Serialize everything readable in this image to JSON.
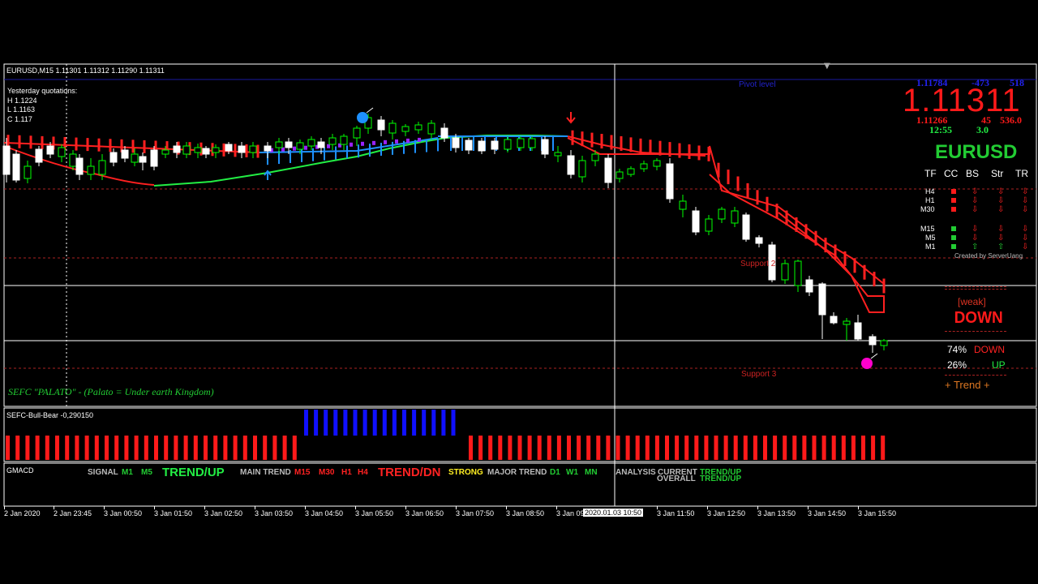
{
  "symbol_header": "EURUSD,M15  1.11301 1.11312 1.11290 1.11311",
  "yesterday": {
    "title": "Yesterday quotations:",
    "high": "H 1.1224",
    "low": "L 1.1163",
    "close": "C 1.117"
  },
  "levels": {
    "pivot": "Pivot level",
    "support2": "Support 2",
    "support3": "Support 3"
  },
  "quote_panel": {
    "top_price": "1.11784",
    "top_spread": "-473",
    "top_count": "518",
    "big_price": "1.11311",
    "low_price": "1.11266",
    "low_a": "45",
    "low_b": "536.0",
    "time": "12:55",
    "time_val": "3.0",
    "symbol": "EURUSD"
  },
  "tf_table": {
    "headers": [
      "TF",
      "CC",
      "BS",
      "Str",
      "TR"
    ],
    "rows": [
      {
        "tf": "H4",
        "cc": "red",
        "bs": "down",
        "str": "down",
        "tr": "down"
      },
      {
        "tf": "H1",
        "cc": "red",
        "bs": "down",
        "str": "down",
        "tr": "down"
      },
      {
        "tf": "M30",
        "cc": "red",
        "bs": "down",
        "str": "down",
        "tr": "down"
      },
      {
        "tf": "M15",
        "cc": "green",
        "bs": "down",
        "str": "down",
        "tr": "down"
      },
      {
        "tf": "M5",
        "cc": "green",
        "bs": "down",
        "str": "down",
        "tr": "down"
      },
      {
        "tf": "M1",
        "cc": "green",
        "bs": "up",
        "str": "up",
        "tr": "down"
      }
    ],
    "credit": "Created by ServerUang"
  },
  "strength": {
    "weak": "[weak]",
    "direction": "DOWN",
    "down_pct": "74%",
    "down_label": "DOWN",
    "up_pct": "26%",
    "up_label": "UP",
    "trend": "+  Trend  +"
  },
  "watermark": "SEFC \"PALATO\" - (Palato = Under earth Kingdom)",
  "bull_bear_label": "SEFC-Bull-Bear -0,290150",
  "gmacd": {
    "label": "GMACD",
    "signal": "SIGNAL",
    "m1": "M1",
    "m5": "M5",
    "trend_up": "TREND/UP",
    "main_trend": "MAIN TREND",
    "m15": "M15",
    "m30": "M30",
    "h1": "H1",
    "h4": "H4",
    "trend_dn": "TREND/DN",
    "strong": "STRONG",
    "major_trend": "MAJOR TREND",
    "d1": "D1",
    "w1": "W1",
    "mn": "MN",
    "analysis": "ANALYSIS",
    "current": "CURRENT",
    "overall": "OVERALL",
    "current_val": "TREND/UP",
    "overall_val": "TREND/UP"
  },
  "time_axis": [
    "2 Jan 2020",
    "2 Jan 23:45",
    "3 Jan 00:50",
    "3 Jan 01:50",
    "3 Jan 02:50",
    "3 Jan 03:50",
    "3 Jan 04:50",
    "3 Jan 05:50",
    "3 Jan 06:50",
    "3 Jan 07:50",
    "3 Jan 08:50",
    "3 Jan 09",
    "3 Jan 11:50",
    "3 Jan 12:50",
    "3 Jan 13:50",
    "3 Jan 14:50",
    "3 Jan 15:50"
  ],
  "crosshair_time": "2020.01.03 10:50",
  "colors": {
    "up_candle": "#ffffff",
    "down_candle": "#00ff00",
    "bear_line": "#ff2020",
    "bull_line": "#22ee44",
    "bar_red": "#ff1a1a",
    "bar_blue": "#1010ff",
    "support": "#cc2222"
  }
}
